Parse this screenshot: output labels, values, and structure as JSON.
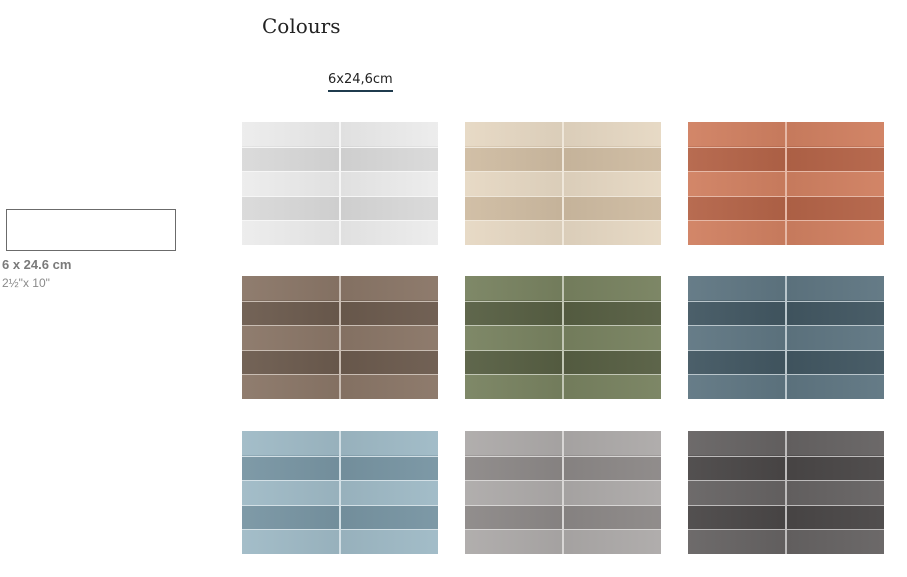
{
  "page": {
    "heading": "Colours"
  },
  "size_tabs": [
    {
      "label": "6x24,6cm",
      "active": true
    }
  ],
  "size_info": {
    "metric": "6 x 24.6 cm",
    "imperial": "2½\"x 10\""
  },
  "swatches": [
    {
      "name": "white",
      "base": "#e3e3e3",
      "light": "#ececec",
      "dark": "#d9d9d9",
      "grout": "#f6f6f6"
    },
    {
      "name": "beige",
      "base": "#dccbb3",
      "light": "#e6d8c3",
      "dark": "#cfbca2",
      "grout": "#efe7da"
    },
    {
      "name": "terracotta",
      "base": "#c47254",
      "light": "#d08061",
      "dark": "#b46448",
      "grout": "#e6b8a6"
    },
    {
      "name": "brown",
      "base": "#7a685a",
      "light": "#8a7667",
      "dark": "#6c5b4e",
      "grout": "#c9bdb3"
    },
    {
      "name": "olive",
      "base": "#66704f",
      "light": "#788260",
      "dark": "#575f43",
      "grout": "#c1c6b4"
    },
    {
      "name": "blue-grey",
      "base": "#506672",
      "light": "#5f7682",
      "dark": "#425762",
      "grout": "#b9c5cb"
    },
    {
      "name": "light-blue",
      "base": "#8aa8b6",
      "light": "#9fbac6",
      "dark": "#7895a3",
      "grout": "#d3e0e6"
    },
    {
      "name": "grey",
      "base": "#9b9797",
      "light": "#adaaa9",
      "dark": "#8c8887",
      "grout": "#d8d6d5"
    },
    {
      "name": "charcoal",
      "base": "#575454",
      "light": "#666363",
      "dark": "#4a4747",
      "grout": "#bdbbbb"
    }
  ]
}
